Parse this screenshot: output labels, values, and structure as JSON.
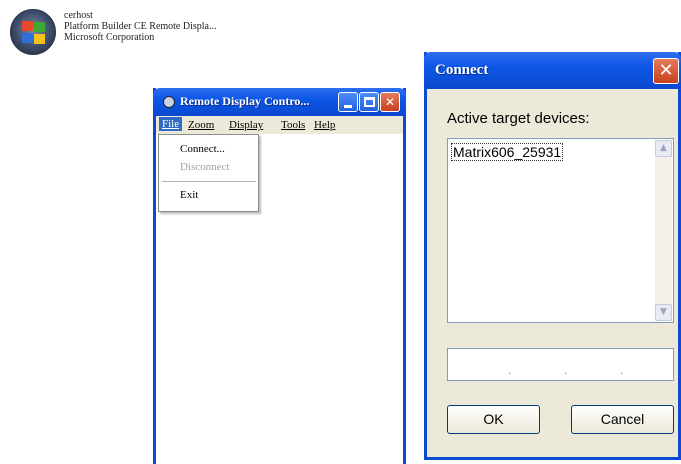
{
  "shortcut": {
    "icon": "windows-ce-icon",
    "line1": "cerhost",
    "line2": "Platform Builder CE Remote Displa...",
    "line3": "Microsoft Corporation"
  },
  "remote_window": {
    "title": "Remote Display Contro...",
    "app_icon": "remote-display-icon",
    "controls": {
      "minimize": "minimize-icon",
      "maximize": "maximize-icon",
      "close_glyph": "✕"
    },
    "menubar": [
      "File",
      "Zoom",
      "Display",
      "Tools",
      "Help"
    ],
    "file_menu": {
      "connect": "Connect...",
      "disconnect": "Disconnect",
      "exit": "Exit"
    }
  },
  "connect_dialog": {
    "title": "Connect",
    "close_glyph": "✕",
    "label": "Active target devices:",
    "devices": [
      "Matrix606_25931"
    ],
    "ip_dots": [
      ".",
      ".",
      "."
    ],
    "ok_label": "OK",
    "cancel_label": "Cancel",
    "scroll_up_glyph": "▲",
    "scroll_down_glyph": "▼"
  },
  "colors": {
    "titlebar": "#0c56e6",
    "close_button": "#c8401f",
    "dialog_face": "#ece9d8",
    "menu_highlight": "#316ac5"
  }
}
